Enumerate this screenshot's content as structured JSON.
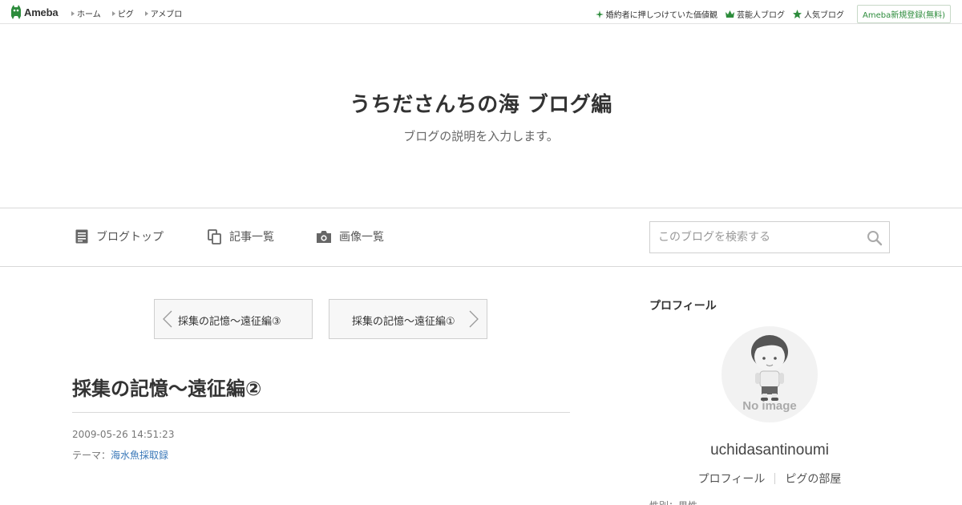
{
  "topbar": {
    "logo_text": "Ameba",
    "nav": [
      "ホーム",
      "ピグ",
      "アメブロ"
    ],
    "right_links": [
      {
        "icon": "sparkle-icon",
        "label": "婚約者に押しつけていた価値観"
      },
      {
        "icon": "crown-icon",
        "label": "芸能人ブログ"
      },
      {
        "icon": "star-icon",
        "label": "人気ブログ"
      }
    ],
    "register_label": "Ameba新規登録(無料)",
    "brand_color": "#2d8c3c"
  },
  "header": {
    "title": "うちださんちの海 ブログ編",
    "description": "ブログの説明を入力します。"
  },
  "navbar": {
    "items": [
      {
        "icon": "document-icon",
        "label": "ブログトップ"
      },
      {
        "icon": "copy-icon",
        "label": "記事一覧"
      },
      {
        "icon": "camera-icon",
        "label": "画像一覧"
      }
    ],
    "search_placeholder": "このブログを検索する"
  },
  "pager": {
    "prev_label": "採集の記憶～遠征編③",
    "next_label": "採集の記憶～遠征編①"
  },
  "article": {
    "title": "採集の記憶～遠征編②",
    "datetime": "2009-05-26 14:51:23",
    "theme_prefix": "テーマ：",
    "theme_link": "海水魚採取録",
    "link_color": "#3a78b8"
  },
  "sidebar": {
    "heading": "プロフィール",
    "avatar_text": "No image",
    "username": "uchidasantinoumi",
    "links": [
      "プロフィール",
      "ピグの部屋"
    ],
    "cut_text": "性別：男性"
  }
}
